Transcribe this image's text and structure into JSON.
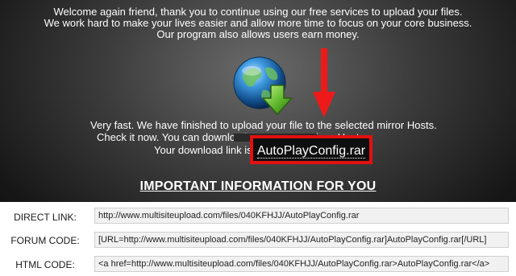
{
  "welcome": {
    "line1": "Welcome again friend, thank you to continue using our free services to upload your files.",
    "line2": "We work hard to make your lives easier and allow more time to focus on your core business.",
    "line3": "Our program also allows users earn money."
  },
  "status": {
    "line1": "Very fast. We have finished to upload your file to the selected mirror Hosts.",
    "line2": "Check it now. You can download your own file in the multiple mirror Hosts.",
    "line2_start": "Check it now. You can download y",
    "line2_end": "irror Hosts.",
    "link_prefix": "Your download link is",
    "link_text": "AutoPlayConfig.rar"
  },
  "icons": {
    "globe": "globe-download-icon",
    "annotation_arrow": "red-arrow-down-icon",
    "annotation_box_color": "#e31010"
  },
  "important_heading": "IMPORTANT INFORMATION FOR YOU",
  "codes": [
    {
      "label": "DIRECT LINK:",
      "value": "http://www.multisiteupload.com/files/040KFHJJ/AutoPlayConfig.rar"
    },
    {
      "label": "FORUM CODE:",
      "value": "[URL=http://www.multisiteupload.com/files/040KFHJJ/AutoPlayConfig.rar]AutoPlayConfig.rar[/URL]"
    },
    {
      "label": "HTML CODE:",
      "value": "<a href=http://www.multisiteupload.com/files/040KFHJJ/AutoPlayConfig.rar>AutoPlayConfig.rar</a>"
    }
  ]
}
